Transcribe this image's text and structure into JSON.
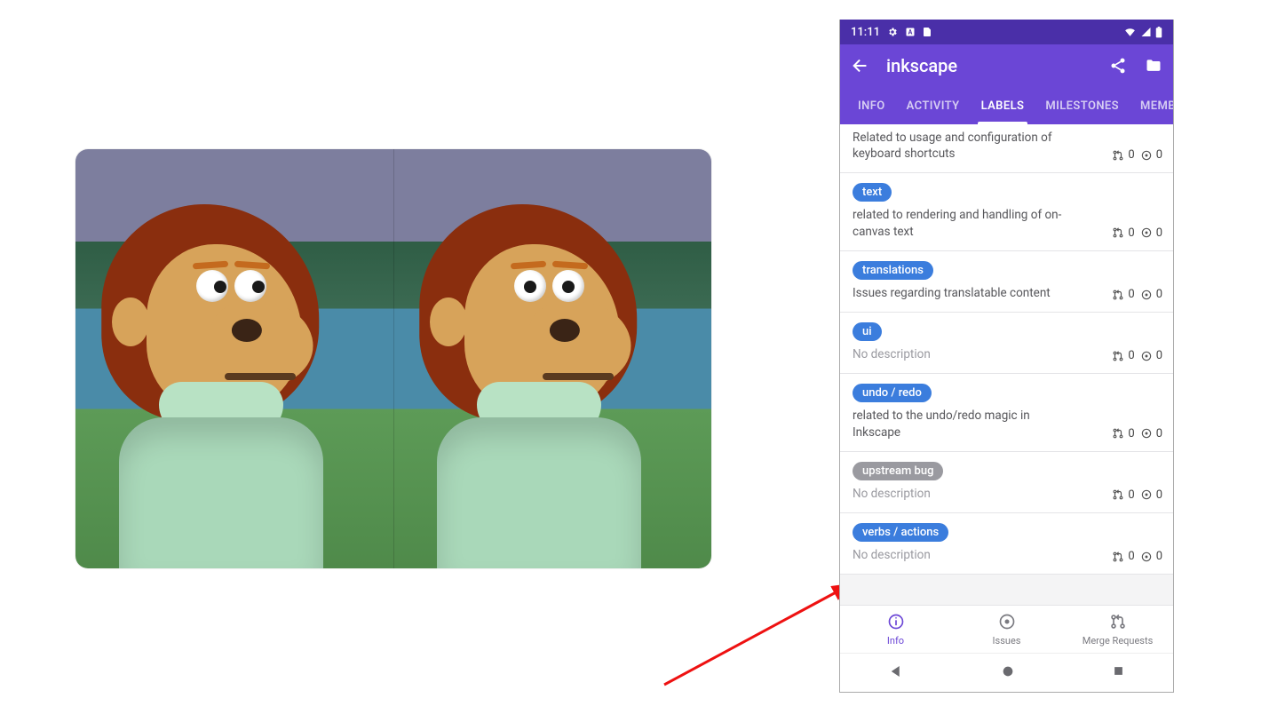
{
  "left_image": {
    "description": "Awkward-look monkey puppet meme, two panels side by side"
  },
  "annotation": {
    "description": "red arrow pointing from lower-left toward bottom of phone screen"
  },
  "phone": {
    "statusbar": {
      "time": "11:11",
      "left_icons": [
        "gear-icon",
        "square-a-icon",
        "sim-icon"
      ],
      "right_icons": [
        "wifi-icon",
        "signal-icon",
        "battery-icon"
      ]
    },
    "appbar": {
      "title": "inkscape",
      "actions": [
        "share-icon",
        "folder-icon"
      ]
    },
    "tabs": [
      {
        "label": "INFO",
        "active": false
      },
      {
        "label": "ACTIVITY",
        "active": false
      },
      {
        "label": "LABELS",
        "active": true
      },
      {
        "label": "MILESTONES",
        "active": false
      },
      {
        "label": "MEMBERS",
        "active": false
      }
    ],
    "labels": [
      {
        "name": "",
        "chip_color": "",
        "description": "Related to usage and configuration of keyboard shortcuts",
        "mr_count": 0,
        "issue_count": 0,
        "first_partial": true
      },
      {
        "name": "text",
        "chip_color": "#3b7ddd",
        "description": "related to rendering and handling of on-canvas text",
        "mr_count": 0,
        "issue_count": 0
      },
      {
        "name": "translations",
        "chip_color": "#3b7ddd",
        "description": "Issues regarding translatable content",
        "mr_count": 0,
        "issue_count": 0
      },
      {
        "name": "ui",
        "chip_color": "#3b7ddd",
        "description": "No description",
        "no_desc": true,
        "mr_count": 0,
        "issue_count": 0
      },
      {
        "name": "undo / redo",
        "chip_color": "#3b7ddd",
        "description": "related to the undo/redo magic in Inkscape",
        "mr_count": 0,
        "issue_count": 0
      },
      {
        "name": "upstream bug",
        "chip_color": "#9a9aa0",
        "description": "No description",
        "no_desc": true,
        "mr_count": 0,
        "issue_count": 0
      },
      {
        "name": "verbs / actions",
        "chip_color": "#3b7ddd",
        "description": "No description",
        "no_desc": true,
        "mr_count": 0,
        "issue_count": 0
      }
    ],
    "bottombar": [
      {
        "label": "Info",
        "icon": "info-icon",
        "active": true
      },
      {
        "label": "Issues",
        "icon": "issue-icon",
        "active": false
      },
      {
        "label": "Merge Requests",
        "icon": "merge-request-icon",
        "active": false
      }
    ]
  }
}
